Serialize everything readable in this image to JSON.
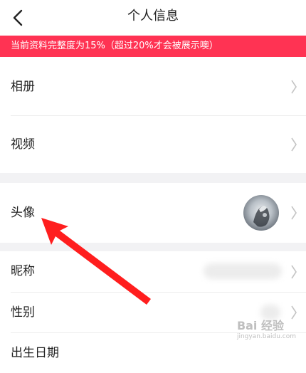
{
  "header": {
    "title": "个人信息",
    "back_icon": "chevron-left-icon"
  },
  "banner": {
    "text": "当前资料完整度为15%（超过20%才会被展示噢）",
    "color": "#ff3353",
    "completeness_percent": 15,
    "threshold_percent": 20
  },
  "rows": {
    "album": {
      "label": "相册"
    },
    "video": {
      "label": "视频"
    },
    "avatar": {
      "label": "头像"
    },
    "nickname": {
      "label": "昵称"
    },
    "gender": {
      "label": "性别"
    },
    "birthday": {
      "label": "出生日期"
    }
  },
  "icons": {
    "row_chevron": "chevron-right-icon",
    "annotation": "red-arrow"
  },
  "watermark": {
    "brand": "Bai 经验",
    "url": "jingyan.baidu.com"
  }
}
